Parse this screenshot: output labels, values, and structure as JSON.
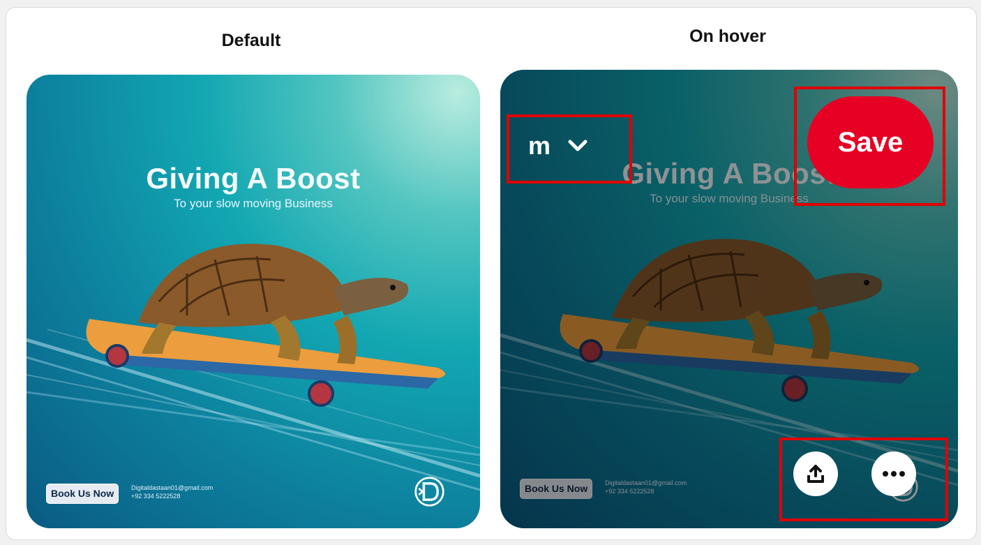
{
  "labels": {
    "default": "Default",
    "hover": "On hover"
  },
  "pin": {
    "headline": "Giving A Boost",
    "subline": "To your slow moving Business",
    "book_button": "Book Us Now",
    "email": "Digitaldastaan01@gmail.com",
    "phone": "+92 334 5222528"
  },
  "hover": {
    "board_name": "m",
    "save_label": "Save",
    "overlay_color": "#000000",
    "save_color": "#e60023",
    "highlight_color": "#e00000"
  },
  "icons": [
    "chevron-down-icon",
    "share-icon",
    "more-icon",
    "brand-logo"
  ]
}
